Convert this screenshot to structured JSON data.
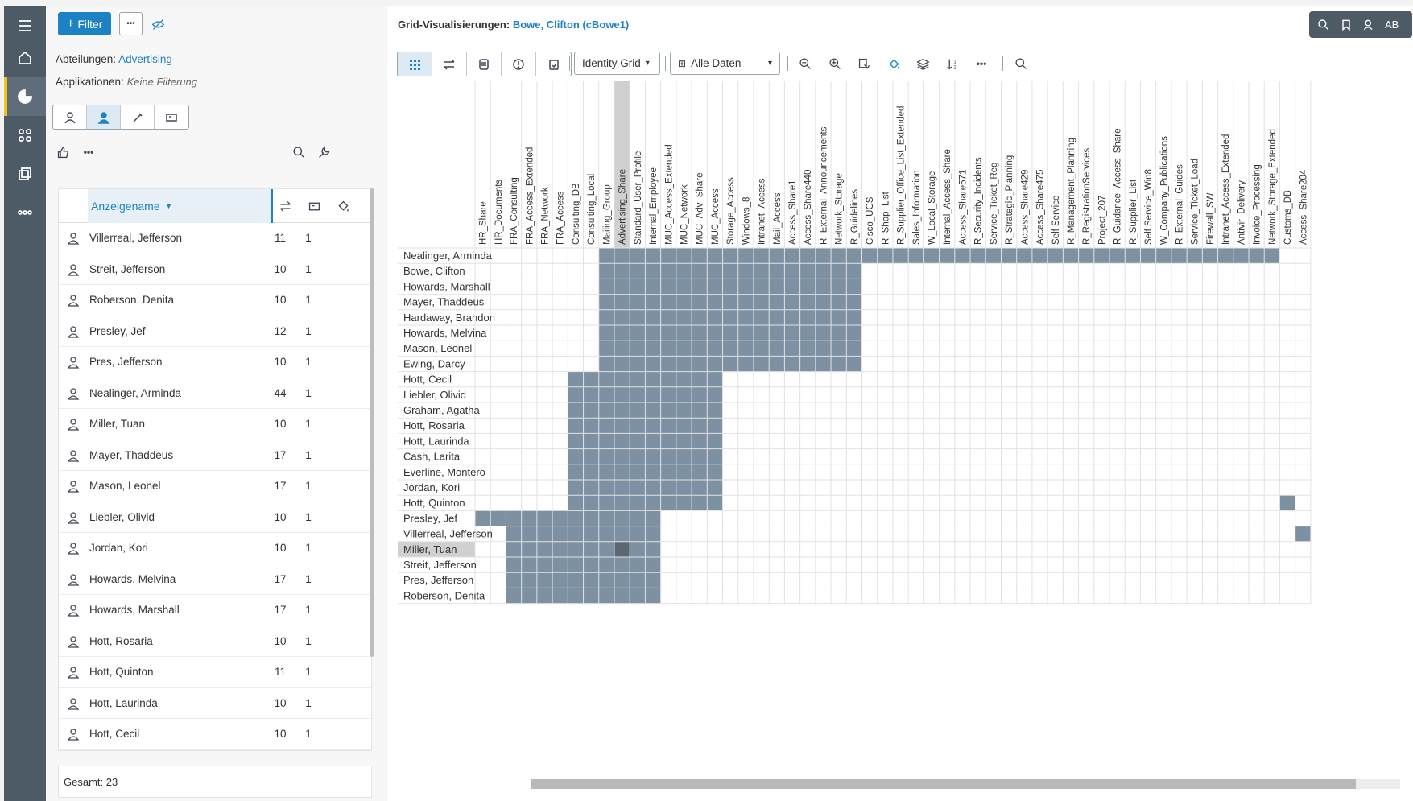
{
  "left_panel": {
    "filter_label": "Filter",
    "more_label": "•••",
    "departments_label": "Abteilungen:",
    "departments_value": "Advertising",
    "applications_label": "Applikationen:",
    "applications_value": "Keine Filterung",
    "toolbar_more": "•••",
    "table": {
      "column_name": "Anzeigename",
      "rows": [
        {
          "name": "Villerreal, Jefferson",
          "c1": "11",
          "c2": "1"
        },
        {
          "name": "Streit, Jefferson",
          "c1": "10",
          "c2": "1"
        },
        {
          "name": "Roberson, Denita",
          "c1": "10",
          "c2": "1"
        },
        {
          "name": "Presley, Jef",
          "c1": "12",
          "c2": "1"
        },
        {
          "name": "Pres, Jefferson",
          "c1": "10",
          "c2": "1"
        },
        {
          "name": "Nealinger, Arminda",
          "c1": "44",
          "c2": "1"
        },
        {
          "name": "Miller, Tuan",
          "c1": "10",
          "c2": "1"
        },
        {
          "name": "Mayer, Thaddeus",
          "c1": "17",
          "c2": "1"
        },
        {
          "name": "Mason, Leonel",
          "c1": "17",
          "c2": "1"
        },
        {
          "name": "Liebler, Olivid",
          "c1": "10",
          "c2": "1"
        },
        {
          "name": "Jordan, Kori",
          "c1": "10",
          "c2": "1"
        },
        {
          "name": "Howards, Melvina",
          "c1": "17",
          "c2": "1"
        },
        {
          "name": "Howards, Marshall",
          "c1": "17",
          "c2": "1"
        },
        {
          "name": "Hott, Rosaria",
          "c1": "10",
          "c2": "1"
        },
        {
          "name": "Hott, Quinton",
          "c1": "11",
          "c2": "1"
        },
        {
          "name": "Hott, Laurinda",
          "c1": "10",
          "c2": "1"
        },
        {
          "name": "Hott, Cecil",
          "c1": "10",
          "c2": "1"
        }
      ]
    },
    "footer": "Gesamt: 23"
  },
  "right_panel": {
    "title_prefix": "Grid-Visualisierungen:",
    "title_user": "Bowe, Clifton (cBowe1)",
    "user_initials": "AB",
    "view_dropdown": "Identity Grid",
    "data_dropdown": "Alle Daten",
    "grid": {
      "columns": [
        "HR_Share",
        "HR_Documents",
        "FRA_Consulting",
        "FRA_Access_Extended",
        "FRA_Network",
        "FRA_Access",
        "Consulting_DB",
        "Consulting_Local",
        "Mailing_Group",
        "Advertising_Share",
        "Standard_User_Profile",
        "Internal_Employee",
        "MUC_Access_Extended",
        "MUC_Network",
        "MUC_Adv_Share",
        "MUC_Access",
        "Storage_Access",
        "Windows_8",
        "Intranet_Access",
        "Mail_Access",
        "Access_Share1",
        "Access_Share440",
        "R_External_Announcements",
        "Network_Storage",
        "R_Guidelines",
        "Cisco_UCS",
        "R_Shop_List",
        "R_Supplier_Office_List_Extended",
        "Sales_Information",
        "W_Local_Storage",
        "Internal_Access_Share",
        "Access_Share571",
        "R_Security_Incidents",
        "Service_Ticket_Reg",
        "R_Strategic_Planning",
        "Access_Share429",
        "Access_Share475",
        "Self Service",
        "R_Management_Planning",
        "R_RegistrationServices",
        "Project_207",
        "R_Guidance_Access_Share",
        "R_Supplier_List",
        "Self Service_Win8",
        "W_Company_Publications",
        "R_External_Guides",
        "Service_Ticket_Load",
        "Firewall_SW",
        "Intranet_Access_Extended",
        "Antivir_Delivery",
        "Invoice_Processing",
        "Network_Storage_Extended",
        "Customs_DB",
        "Access_Share204"
      ],
      "highlight_column": 9,
      "highlight_row": 19,
      "rows": [
        {
          "name": "Nealinger, Arminda",
          "cells": [
            [
              8,
              52
            ]
          ]
        },
        {
          "name": "Bowe, Clifton",
          "cells": [
            [
              8,
              25
            ]
          ]
        },
        {
          "name": "Howards, Marshall",
          "cells": [
            [
              8,
              25
            ]
          ]
        },
        {
          "name": "Mayer, Thaddeus",
          "cells": [
            [
              8,
              25
            ]
          ]
        },
        {
          "name": "Hardaway, Brandon",
          "cells": [
            [
              8,
              25
            ]
          ]
        },
        {
          "name": "Howards, Melvina",
          "cells": [
            [
              8,
              25
            ]
          ]
        },
        {
          "name": "Mason, Leonel",
          "cells": [
            [
              8,
              25
            ]
          ]
        },
        {
          "name": "Ewing, Darcy",
          "cells": [
            [
              8,
              25
            ]
          ]
        },
        {
          "name": "Hott, Cecil",
          "cells": [
            [
              6,
              16
            ]
          ]
        },
        {
          "name": "Liebler, Olivid",
          "cells": [
            [
              6,
              16
            ]
          ]
        },
        {
          "name": "Graham, Agatha",
          "cells": [
            [
              6,
              16
            ]
          ]
        },
        {
          "name": "Hott, Rosaria",
          "cells": [
            [
              6,
              16
            ]
          ]
        },
        {
          "name": "Hott, Laurinda",
          "cells": [
            [
              6,
              16
            ]
          ]
        },
        {
          "name": "Cash, Larita",
          "cells": [
            [
              6,
              16
            ]
          ]
        },
        {
          "name": "Everline, Montero",
          "cells": [
            [
              6,
              16
            ]
          ]
        },
        {
          "name": "Jordan, Kori",
          "cells": [
            [
              6,
              16
            ]
          ]
        },
        {
          "name": "Hott, Quinton",
          "cells": [
            [
              6,
              16
            ],
            [
              52,
              53
            ]
          ]
        },
        {
          "name": "Presley, Jef",
          "cells": [
            [
              0,
              12
            ]
          ]
        },
        {
          "name": "Villerreal, Jefferson",
          "cells": [
            [
              2,
              12
            ],
            [
              53,
              54
            ]
          ]
        },
        {
          "name": "Miller, Tuan",
          "cells": [
            [
              2,
              12
            ]
          ]
        },
        {
          "name": "Streit, Jefferson",
          "cells": [
            [
              2,
              12
            ]
          ]
        },
        {
          "name": "Pres, Jefferson",
          "cells": [
            [
              2,
              12
            ]
          ]
        },
        {
          "name": "Roberson, Denita",
          "cells": [
            [
              2,
              12
            ]
          ]
        }
      ]
    }
  },
  "colors": {
    "accent": "#1d82c5",
    "nav_bg": "#4d5b67",
    "cell_fill": "#7d91a3",
    "cell_selected": "#5a6873",
    "active_marker": "#f0c419"
  }
}
